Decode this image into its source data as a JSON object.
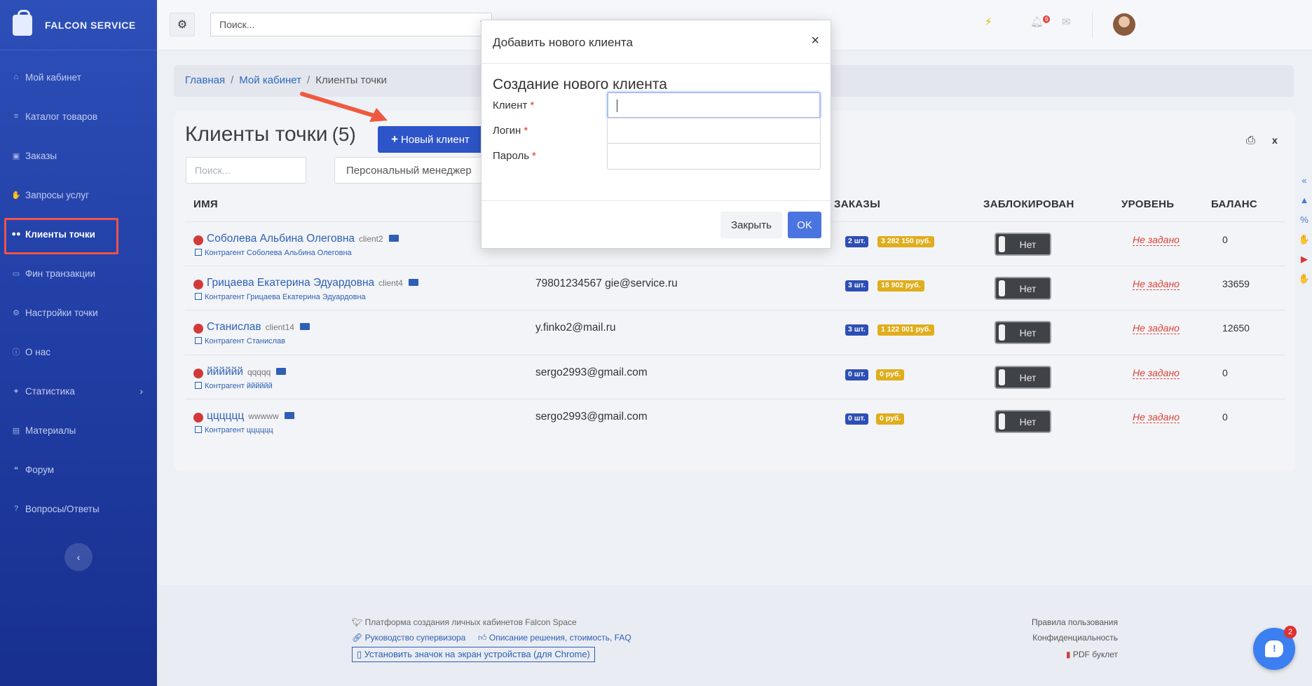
{
  "brand": {
    "name": "FALCON SERVICE"
  },
  "sidebar": {
    "items": [
      {
        "label": "Мой кабинет",
        "icon": "home-icon"
      },
      {
        "label": "Каталог товаров",
        "icon": "list-icon"
      },
      {
        "label": "Заказы",
        "icon": "bag-icon"
      },
      {
        "label": "Запросы услуг",
        "icon": "hand-icon"
      },
      {
        "label": "Клиенты точки",
        "icon": "users-icon",
        "active": true
      },
      {
        "label": "Фин транзакции",
        "icon": "money-icon"
      },
      {
        "label": "Настройки точки",
        "icon": "gears-icon"
      },
      {
        "label": "О нас",
        "icon": "info-icon"
      },
      {
        "label": "Статистика",
        "icon": "bulb-icon"
      },
      {
        "label": "Материалы",
        "icon": "sitemap-icon"
      },
      {
        "label": "Форум",
        "icon": "comments-icon"
      },
      {
        "label": "Вопросы/Ответы",
        "icon": "question-icon"
      }
    ]
  },
  "topbar": {
    "search_placeholder": "Поиск...",
    "notif_count": "6"
  },
  "breadcrumb": {
    "home": "Главная",
    "cabinet": "Мой кабинет",
    "current": "Клиенты точки"
  },
  "page": {
    "title": "Клиенты точки",
    "count": "(5)",
    "new_button": "Новый клиент",
    "search_placeholder": "Поиск...",
    "manager_filter": "Персональный менеджер"
  },
  "table": {
    "headers": {
      "name": "ИМЯ",
      "orders": "ЗАКАЗЫ",
      "blocked": "ЗАБЛОКИРОВАН",
      "level": "УРОВЕНЬ",
      "balance": "БАЛАНС"
    },
    "rows": [
      {
        "name": "Соболева Альбина Олеговна",
        "login": "client2",
        "contractor": "Контрагент Соболева Альбина Олеговна",
        "contact": "",
        "qty": "2 шт.",
        "sum": "3 282 150 руб.",
        "blocked": "Нет",
        "level": "Не задано",
        "balance": "0"
      },
      {
        "name": "Грицаева Екатерина Эдуардовна",
        "login": "client4",
        "contractor": "Контрагент Грицаева Екатерина Эдуардовна",
        "contact": "79801234567 gie@service.ru",
        "qty": "3 шт.",
        "sum": "18 902 руб.",
        "blocked": "Нет",
        "level": "Не задано",
        "balance": "33659"
      },
      {
        "name": "Станислав",
        "login": "client14",
        "contractor": "Контрагент Станислав",
        "contact": "y.finko2@mail.ru",
        "qty": "3 шт.",
        "sum": "1 122 001 руб.",
        "blocked": "Нет",
        "level": "Не задано",
        "balance": "12650"
      },
      {
        "name": "йййййй",
        "login": "qqqqq",
        "contractor": "Контрагент йййййй",
        "contact": "sergo2993@gmail.com",
        "qty": "0 шт.",
        "sum": "0 руб.",
        "blocked": "Нет",
        "level": "Не задано",
        "balance": "0"
      },
      {
        "name": "цццццц",
        "login": "wwwww",
        "contractor": "Контрагент цццццц",
        "contact": "sergo2993@gmail.com",
        "qty": "0 шт.",
        "sum": "0 руб.",
        "blocked": "Нет",
        "level": "Не задано",
        "balance": "0"
      }
    ]
  },
  "modal": {
    "title": "Добавить нового клиента",
    "subtitle": "Создание нового клиента",
    "fields": {
      "client": "Клиент",
      "login": "Логин",
      "password": "Пароль"
    },
    "required_mark": "*",
    "close_button": "Закрыть",
    "ok_button": "OK"
  },
  "footer": {
    "platform": "Платформа создания личных кабинетов Falcon Space",
    "guide": "Руководство супервизора",
    "description": "Описание решения, стоимость, FAQ",
    "install": "Установить значок на экран устройства (для Chrome)",
    "terms": "Правила пользования",
    "privacy": "Конфиденциальность",
    "pdf": "PDF буклет"
  },
  "chat": {
    "badge": "2"
  },
  "colors": {
    "sidebar": "#2341a8",
    "accent": "#2d55c9",
    "danger": "#d23a3a",
    "warning": "#e0ad1c"
  }
}
